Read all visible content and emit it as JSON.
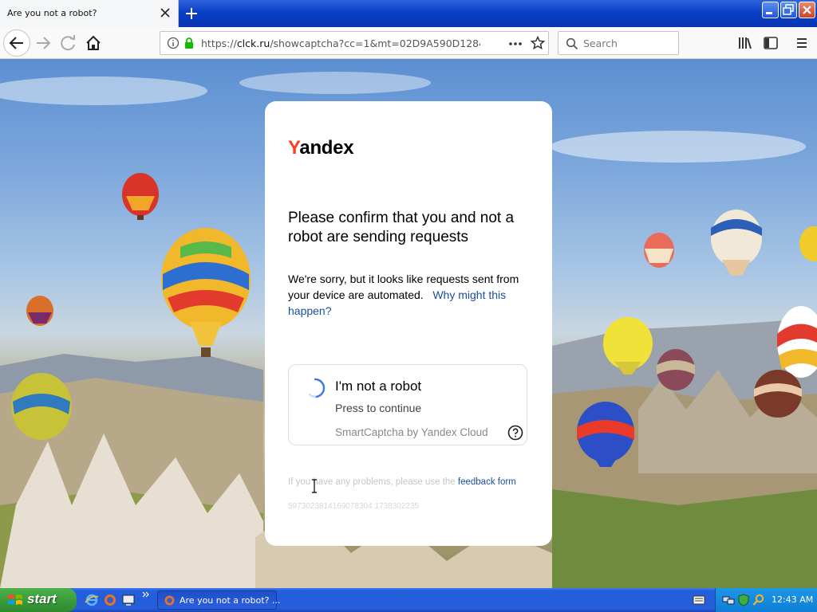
{
  "browser": {
    "tab": {
      "title": "Are you not a robot?"
    },
    "url": {
      "prefix": "https://",
      "host": "clck.ru",
      "path": "/showcaptcha?cc=1&mt=02D9A590D1284F1D4"
    },
    "search": {
      "placeholder": "Search"
    }
  },
  "card": {
    "logo_y": "Y",
    "logo_rest": "andex",
    "heading": "Please confirm that you and not a robot are sending requests",
    "paragraph": "We're sorry, but it looks like requests sent from your device are automated.",
    "why_link": "Why might this happen?",
    "captcha": {
      "title": "I'm not a robot",
      "subtitle": "Press to continue",
      "brand": "SmartCaptcha by Yandex Cloud"
    },
    "footer_text": "If you have any problems, please use the",
    "feedback_link": "feedback form",
    "request_id": "5973023814169078304:1738302235"
  },
  "taskbar": {
    "start_label": "start",
    "window_label": "Are you not a robot? ...",
    "clock": "12:43 AM"
  },
  "colors": {
    "yandex_red": "#fc3f1d",
    "link_blue": "#1a4e9c",
    "xp_blue": "#245edb",
    "start_green": "#3c9e3c"
  }
}
